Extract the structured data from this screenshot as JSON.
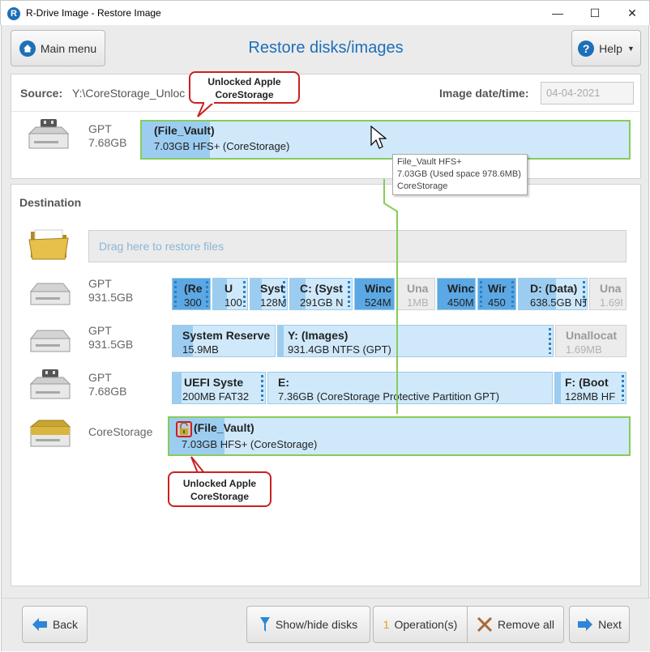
{
  "window": {
    "title": "R-Drive Image - Restore Image",
    "app_icon_letter": "R",
    "minimize_glyph": "—",
    "maximize_glyph": "☐",
    "close_glyph": "✕"
  },
  "header": {
    "main_menu_label": "Main menu",
    "heading": "Restore disks/images",
    "help_label": "Help",
    "help_icon_glyph": "?",
    "dropdown_glyph": "▼"
  },
  "source": {
    "label": "Source:",
    "path": "Y:\\CoreStorage_Unloc",
    "date_label": "Image date/time:",
    "date_value": "04-04-2021",
    "disk_type": "GPT",
    "disk_size": "7.68GB",
    "partition": {
      "name": "(File_Vault)",
      "desc": "7.03GB HFS+ (CoreStorage)",
      "used_fraction": 0.14
    }
  },
  "tooltip": {
    "line1": "File_Vault HFS+",
    "line2": "7.03GB (Used space 978.6MB)",
    "line3": "CoreStorage"
  },
  "callouts": {
    "top": {
      "line1": "Unlocked Apple",
      "line2": "CoreStorage"
    },
    "bottom": {
      "line1": "Unlocked Apple",
      "line2": "CoreStorage"
    }
  },
  "destination": {
    "label": "Destination",
    "dropzone_text": "Drag here to restore files",
    "disks": [
      {
        "type": "GPT",
        "size": "931.5GB",
        "partitions": [
          {
            "name": "(Re",
            "desc": "300"
          },
          {
            "name": "U",
            "desc": "100"
          },
          {
            "name": "Syst",
            "desc": "128M"
          },
          {
            "name": "C: (Syst",
            "desc": "291GB N"
          },
          {
            "name": "Winc",
            "desc": "524M"
          },
          {
            "name": "Una",
            "desc": "1MB"
          },
          {
            "name": "Winc",
            "desc": "450M"
          },
          {
            "name": "Wir",
            "desc": "450"
          },
          {
            "name": "D: (Data)",
            "desc": "638.5GB NT"
          },
          {
            "name": "Una",
            "desc": "1.69I"
          }
        ]
      },
      {
        "type": "GPT",
        "size": "931.5GB",
        "partitions": [
          {
            "name": "System Reserve",
            "desc": "15.9MB"
          },
          {
            "name": "Y: (Images)",
            "desc": "931.4GB NTFS (GPT)"
          },
          {
            "name": "Unallocat",
            "desc": "1.69MB"
          }
        ]
      },
      {
        "type": "GPT",
        "size": "7.68GB",
        "partitions": [
          {
            "name": "UEFI Syste",
            "desc": "200MB FAT32"
          },
          {
            "name": "E:",
            "desc": "7.36GB (CoreStorage Protective Partition GPT)"
          },
          {
            "name": "F: (Boot",
            "desc": "128MB HF"
          }
        ]
      },
      {
        "type": "CoreStorage",
        "size": "",
        "partitions": [
          {
            "name": "(File_Vault)",
            "desc": "7.03GB HFS+ (CoreStorage)",
            "used_fraction": 0.12
          }
        ]
      }
    ]
  },
  "footer": {
    "back_label": "Back",
    "show_hide_label": "Show/hide disks",
    "operations_count": "1",
    "operations_label": "Operation(s)",
    "remove_all_label": "Remove all",
    "next_label": "Next"
  },
  "colors": {
    "accent": "#1d6fb8",
    "partition_fill": "#cfe9fb",
    "partition_used": "#9ccdf1",
    "selection_border": "#86cc5a",
    "callout_border": "#cc2020"
  }
}
